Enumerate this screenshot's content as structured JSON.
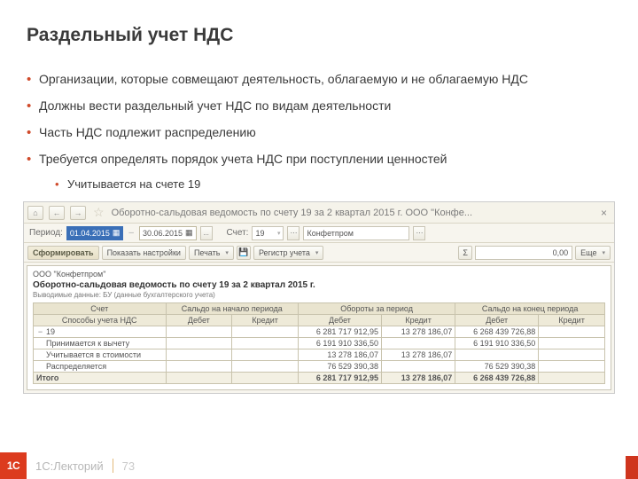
{
  "slide": {
    "title": "Раздельный учет НДС",
    "bullets": [
      "Организации, которые совмещают деятельность, облагаемую и не облагаемую НДС",
      "Должны вести раздельный учет НДС по видам деятельности",
      "Часть НДС подлежит распределению",
      "Требуется определять порядок учета НДС при поступлении ценностей"
    ],
    "sub_bullet": "Учитывается на счете 19"
  },
  "app": {
    "window_title": "Оборотно-сальдовая ведомость по счету 19 за 2 квартал 2015 г. ООО \"Конфе...",
    "period_label": "Период:",
    "date_from": "01.04.2015",
    "date_to": "30.06.2015",
    "ellipsis": "...",
    "account_label": "Счет:",
    "account_value": "19",
    "org_value": "Конфетпром",
    "tb_form": "Сформировать",
    "tb_show_settings": "Показать настройки",
    "tb_print": "Печать",
    "tb_register": "Регистр учета",
    "sum_value": "0,00",
    "tb_more": "Еще",
    "sigma": "Σ",
    "report": {
      "org": "ООО \"Конфетпром\"",
      "title": "Оборотно-сальдовая ведомость по счету 19 за 2 квартал 2015 г.",
      "subtitle": "Выводимые данные: БУ (данные бухгалтерского учета)"
    },
    "headers": {
      "acct": "Счет",
      "method": "Способы учета НДС",
      "g1": "Сальдо на начало периода",
      "g2": "Обороты за период",
      "g3": "Сальдо на конец периода",
      "debit": "Дебет",
      "credit": "Кредит"
    },
    "rows": [
      {
        "label": "19",
        "toggle": "−",
        "d1": "",
        "c1": "",
        "d2": "6 281 717 912,95",
        "c2": "13 278 186,07",
        "d3": "6 268 439 726,88",
        "c3": ""
      },
      {
        "label": "Принимается к вычету",
        "indent": true,
        "d1": "",
        "c1": "",
        "d2": "6 191 910 336,50",
        "c2": "",
        "d3": "6 191 910 336,50",
        "c3": ""
      },
      {
        "label": "Учитывается в стоимости",
        "indent": true,
        "d1": "",
        "c1": "",
        "d2": "13 278 186,07",
        "c2": "13 278 186,07",
        "d3": "",
        "c3": ""
      },
      {
        "label": "Распределяется",
        "indent": true,
        "d1": "",
        "c1": "",
        "d2": "76 529 390,38",
        "c2": "",
        "d3": "76 529 390,38",
        "c3": ""
      }
    ],
    "total": {
      "label": "Итого",
      "d1": "",
      "c1": "",
      "d2": "6 281 717 912,95",
      "c2": "13 278 186,07",
      "d3": "6 268 439 726,88",
      "c3": ""
    }
  },
  "footer": {
    "logo": "1С",
    "brand": "1С:Лекторий",
    "page": "73"
  }
}
